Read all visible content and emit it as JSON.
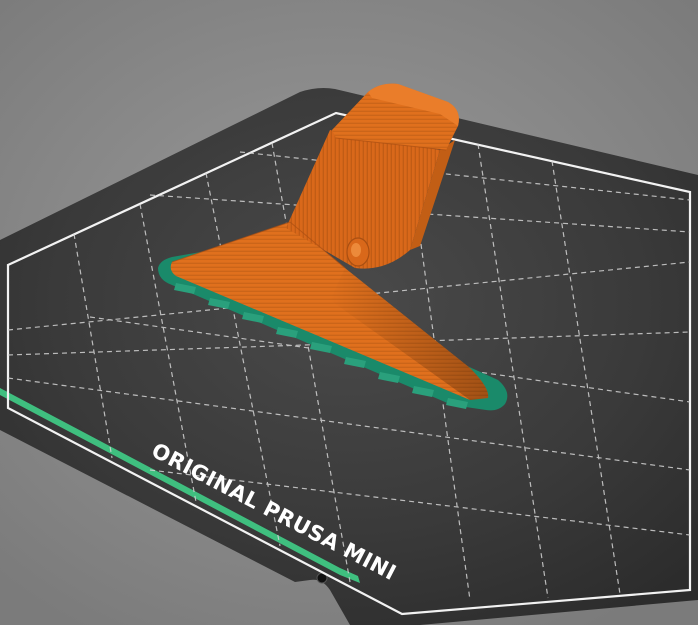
{
  "viewport": {
    "bed_label": "ORIGINAL PRUSA MINI",
    "colors": {
      "background": "#8e8e8e",
      "bed_surface": "#343434",
      "bed_border": "#f2f2f2",
      "grid_line": "#d4d4d4",
      "bed_label": "#ffffff",
      "bed_strip": "#3fbf7f",
      "model": "#e0701d",
      "model_shadow": "#b5530f",
      "brim": "#1a8a6a"
    },
    "icons": {
      "print_bed": "print-bed",
      "model": "vacuum-nozzle-model",
      "bed_screw": "screw-hole"
    }
  }
}
